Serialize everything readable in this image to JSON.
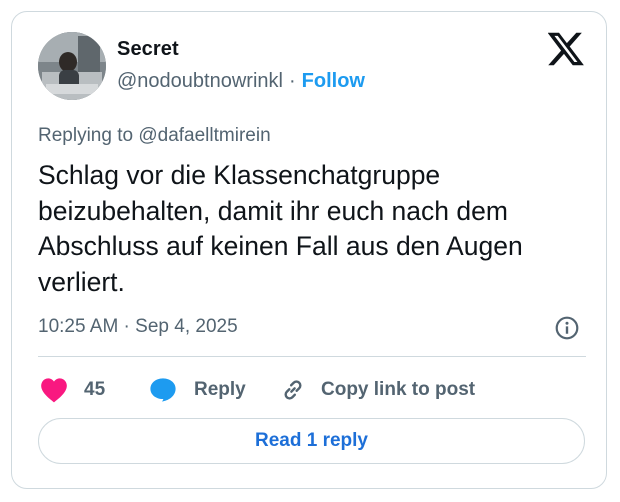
{
  "author": {
    "display_name": "Secret",
    "handle": "@nodoubtnowrinkl",
    "separator": "·",
    "follow_label": "Follow"
  },
  "reply_context": {
    "prefix": "Replying to",
    "mention": "@dafaelltmirein"
  },
  "tweet": {
    "text": "Schlag vor die Klassenchatgruppe beizubehalten, damit ihr euch nach dem Abschluss auf keinen Fall aus den Augen verliert.",
    "timestamp": "10:25 AM · Sep 4, 2025"
  },
  "actions": {
    "like_count": "45",
    "reply_label": "Reply",
    "copy_link_label": "Copy link to post"
  },
  "read_replies_label": "Read 1 reply",
  "icons": {
    "platform_logo": "x-logo-icon",
    "info": "info-icon",
    "like": "heart-icon",
    "reply": "speech-bubble-icon",
    "copy_link": "link-icon"
  },
  "colors": {
    "accent_blue": "#1d9bf0",
    "like_pink": "#f91880",
    "text_primary": "#0f1419",
    "text_secondary": "#536471",
    "border": "#cfd9de"
  }
}
